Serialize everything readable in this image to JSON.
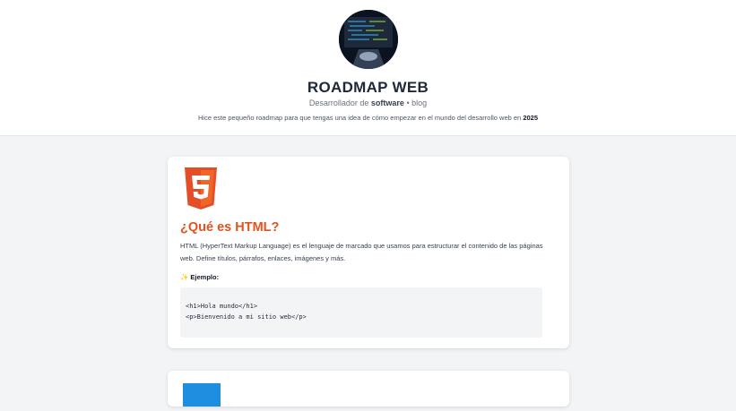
{
  "header": {
    "avatar_alt": "code-photo",
    "title": "ROADMAP WEB",
    "subtitle_prefix": "Desarrollador de",
    "subtitle_strong": "software",
    "subtitle_suffix": "• blog",
    "intro_text": "Hice este pequeño roadmap para que tengas una idea de cómo empezar en el mundo del desarrollo web en",
    "intro_year": "2025"
  },
  "cards": [
    {
      "icon": "html5-icon",
      "title": "¿Qué es HTML?",
      "description": "HTML (HyperText Markup Language) es el lenguaje de marcado que usamos para estructurar el contenido de las páginas web. Define títulos, párrafos, enlaces, imágenes y más.",
      "example_label": "✨ Ejemplo:",
      "code_lines": [
        "<h1>Hola mundo</h1>",
        "<p>Bienvenido a mi sitio web</p>"
      ]
    },
    {
      "icon": "css3-icon"
    }
  ],
  "colors": {
    "accent": "#e4521c",
    "html_orange": "#e44d26",
    "css_blue": "#1f8de0",
    "background": "#f3f4f6"
  }
}
